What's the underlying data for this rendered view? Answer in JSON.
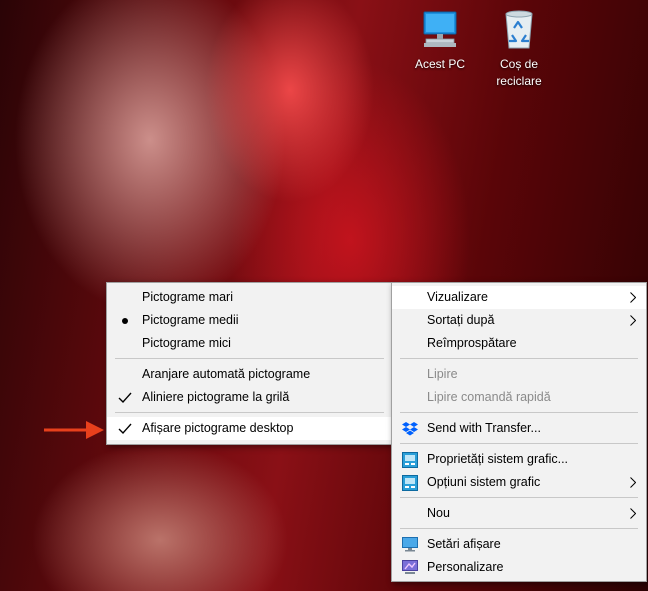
{
  "desktop": {
    "icons": [
      {
        "label": "Acest PC",
        "icon": "this-pc-icon"
      },
      {
        "label": "Coș de reciclare",
        "icon": "recycle-bin-icon"
      }
    ],
    "pointer_color": "#e8401c"
  },
  "view_submenu": {
    "items": [
      {
        "label": "Pictograme mari",
        "mark": "none"
      },
      {
        "label": "Pictograme medii",
        "mark": "bullet"
      },
      {
        "label": "Pictograme mici",
        "mark": "none"
      },
      {
        "label": "Aranjare automată pictograme",
        "mark": "none"
      },
      {
        "label": "Aliniere pictograme la grilă",
        "mark": "check"
      },
      {
        "label": "Afișare pictograme desktop",
        "mark": "check",
        "highlighted": true
      }
    ]
  },
  "context_menu": {
    "items": [
      {
        "label": "Vizualizare",
        "submenu": true,
        "highlighted": true
      },
      {
        "label": "Sortați după",
        "submenu": true
      },
      {
        "label": "Reîmprospătare"
      },
      {
        "label": "Lipire",
        "disabled": true
      },
      {
        "label": "Lipire comandă rapidă",
        "disabled": true
      },
      {
        "label": "Send with Transfer...",
        "icon": "dropbox-icon"
      },
      {
        "label": "Proprietăți sistem grafic...",
        "icon": "intel-graphics-icon"
      },
      {
        "label": "Opțiuni sistem grafic",
        "icon": "intel-graphics-icon",
        "submenu": true
      },
      {
        "label": "Nou",
        "submenu": true
      },
      {
        "label": "Setări afișare",
        "icon": "display-settings-icon"
      },
      {
        "label": "Personalizare",
        "icon": "personalize-icon"
      }
    ]
  }
}
